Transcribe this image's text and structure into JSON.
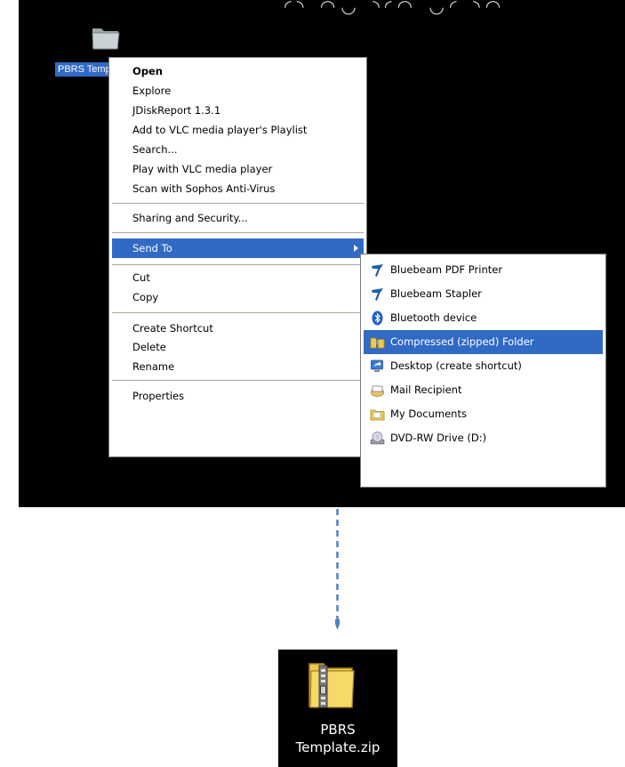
{
  "desktop": {
    "folder_label": "PBRS Temp"
  },
  "context_menu": {
    "items": [
      {
        "label": "Open"
      },
      {
        "label": "Explore"
      },
      {
        "label": "JDiskReport 1.3.1"
      },
      {
        "label": "Add to VLC media player's Playlist"
      },
      {
        "label": "Search..."
      },
      {
        "label": "Play with VLC media player"
      },
      {
        "label": "Scan with Sophos Anti-Virus"
      },
      {
        "label": "Sharing and Security..."
      },
      {
        "label": "Send To"
      },
      {
        "label": "Cut"
      },
      {
        "label": "Copy"
      },
      {
        "label": "Create Shortcut"
      },
      {
        "label": "Delete"
      },
      {
        "label": "Rename"
      },
      {
        "label": "Properties"
      }
    ],
    "default_item": "Open",
    "highlighted_item": "Send To"
  },
  "send_to_menu": {
    "items": [
      {
        "label": "Bluebeam PDF Printer",
        "icon": "bluebeam-icon"
      },
      {
        "label": "Bluebeam Stapler",
        "icon": "bluebeam-icon"
      },
      {
        "label": "Bluetooth device",
        "icon": "bluetooth-icon"
      },
      {
        "label": "Compressed (zipped) Folder",
        "icon": "zip-folder-icon"
      },
      {
        "label": "Desktop (create shortcut)",
        "icon": "desktop-shortcut-icon"
      },
      {
        "label": "Mail Recipient",
        "icon": "mail-icon"
      },
      {
        "label": "My Documents",
        "icon": "my-documents-icon"
      },
      {
        "label": "DVD-RW Drive (D:)",
        "icon": "dvd-drive-icon"
      }
    ],
    "highlighted_item": "Compressed (zipped) Folder"
  },
  "result": {
    "line1": "PBRS",
    "line2": "Template.zip"
  },
  "colors": {
    "selection": "#316ac5",
    "desktop": "#000000",
    "arrow": "#4f81bd"
  }
}
